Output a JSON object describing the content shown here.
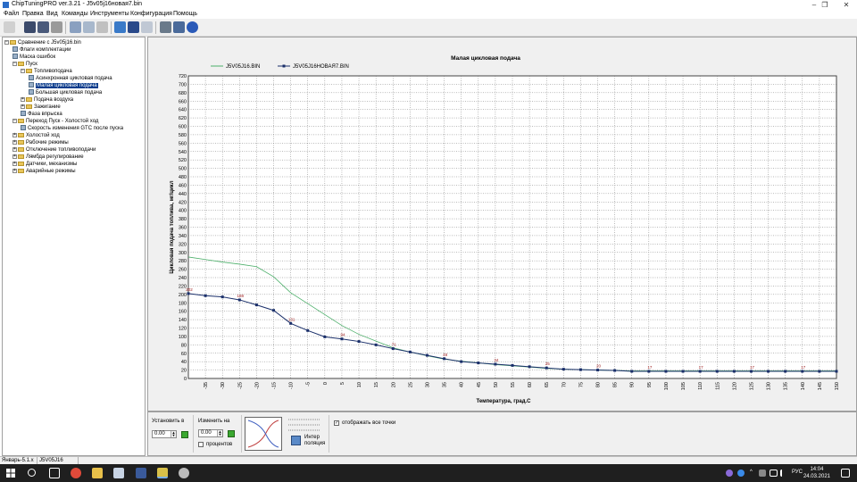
{
  "window": {
    "title": "ChipTuningPRO ver.3.21 - J5v05j16новая7.bin",
    "minimize": "–",
    "maximize": "❐",
    "close": "✕"
  },
  "menu": [
    "Файл",
    "Правка",
    "Вид",
    "Команды",
    "Инструменты",
    "Конфигурация",
    "Помощь"
  ],
  "tree": [
    {
      "label": "Сравнение с J5v05j16.bin",
      "level": 0,
      "exp": "−",
      "kind": "folder"
    },
    {
      "label": "Флаги комплектации",
      "level": 1,
      "exp": "",
      "kind": "leaf"
    },
    {
      "label": "Маска ошибок",
      "level": 1,
      "exp": "",
      "kind": "leaf"
    },
    {
      "label": "Пуск",
      "level": 1,
      "exp": "−",
      "kind": "folder"
    },
    {
      "label": "Топливоподача",
      "level": 2,
      "exp": "−",
      "kind": "folder"
    },
    {
      "label": "Асинхронная цикловая подача",
      "level": 3,
      "exp": "",
      "kind": "leaf"
    },
    {
      "label": "Малая цикловая подача",
      "level": 3,
      "exp": "",
      "kind": "leaf",
      "selected": true
    },
    {
      "label": "Большая цикловая подача",
      "level": 3,
      "exp": "",
      "kind": "leaf"
    },
    {
      "label": "Подача воздуха",
      "level": 2,
      "exp": "+",
      "kind": "folder"
    },
    {
      "label": "Зажигание",
      "level": 2,
      "exp": "+",
      "kind": "folder"
    },
    {
      "label": "Фаза впрыска",
      "level": 2,
      "exp": "",
      "kind": "leaf"
    },
    {
      "label": "Переход Пуск - Холостой ход",
      "level": 1,
      "exp": "−",
      "kind": "folder"
    },
    {
      "label": "Скорость изменения GTC после пуска",
      "level": 2,
      "exp": "",
      "kind": "leaf"
    },
    {
      "label": "Холостой ход",
      "level": 1,
      "exp": "+",
      "kind": "folder"
    },
    {
      "label": "Рабочие режимы",
      "level": 1,
      "exp": "+",
      "kind": "folder"
    },
    {
      "label": "Отключение топливоподачи",
      "level": 1,
      "exp": "+",
      "kind": "folder"
    },
    {
      "label": "Лямбда регулирование",
      "level": 1,
      "exp": "+",
      "kind": "folder"
    },
    {
      "label": "Датчики, механизмы",
      "level": 1,
      "exp": "+",
      "kind": "folder"
    },
    {
      "label": "Аварийные режимы",
      "level": 1,
      "exp": "+",
      "kind": "folder"
    }
  ],
  "bottom": {
    "set_label": "Установить в",
    "set_value": "0.00",
    "change_label": "Изменить на",
    "change_value": "0.00",
    "percent_label": "процентов",
    "interp_label_1": "Интер",
    "interp_label_2": "поляция",
    "show_all_label": "отображать все точки",
    "show_all_checked": "✓"
  },
  "status": [
    "Январь-5.1.x",
    "J5V05J16"
  ],
  "taskbar": {
    "lang": "РУС",
    "time": "14:04",
    "date": "24.03.2021"
  },
  "chart_data": {
    "type": "line",
    "title": "Малая цикловая подача",
    "xlabel": "Температура, град.С",
    "ylabel": "Цикловая подача топлива, мг/цикл",
    "x": [
      -40,
      -35,
      -30,
      -25,
      -20,
      -15,
      -10,
      -5,
      0,
      5,
      10,
      15,
      20,
      25,
      30,
      35,
      40,
      45,
      50,
      55,
      60,
      65,
      70,
      75,
      80,
      85,
      90,
      95,
      100,
      105,
      110,
      115,
      120,
      125,
      130,
      135,
      140,
      145,
      150
    ],
    "xlim": [
      -40,
      150
    ],
    "ylim": [
      0,
      720
    ],
    "ytick_step": 20,
    "xticks": [
      -35,
      -30,
      -25,
      -20,
      -15,
      -10,
      -5,
      0,
      5,
      10,
      15,
      20,
      25,
      30,
      35,
      40,
      45,
      50,
      55,
      60,
      65,
      70,
      75,
      80,
      85,
      90,
      95,
      100,
      105,
      110,
      115,
      120,
      125,
      130,
      135,
      140,
      145,
      150
    ],
    "series": [
      {
        "name": "J5V05J16.BIN",
        "color": "#4caf6a",
        "marker": false,
        "values": [
          289,
          283,
          277,
          272,
          266,
          242,
          204,
          178,
          152,
          126,
          105,
          89,
          73,
          63,
          54,
          46,
          41,
          37,
          33,
          30,
          27,
          24,
          22,
          21,
          20,
          19,
          18,
          18,
          18,
          18,
          18,
          18,
          18,
          18,
          18,
          18,
          18,
          18,
          18
        ]
      },
      {
        "name": "J5V05J16НОВАЯ7.BIN",
        "color": "#1a2f6a",
        "marker": true,
        "values": [
          202,
          197,
          194,
          187,
          175,
          162,
          131,
          114,
          99,
          94,
          88,
          80,
          71,
          63,
          55,
          47,
          40,
          37,
          34,
          31,
          28,
          25,
          22,
          21,
          20,
          19,
          17,
          17,
          17,
          17,
          17,
          17,
          17,
          17,
          17,
          17,
          17,
          17,
          17
        ]
      }
    ],
    "point_labels": [
      {
        "x": -40,
        "y": 202,
        "text": "202"
      },
      {
        "x": -25,
        "y": 187,
        "text": "188"
      },
      {
        "x": -10,
        "y": 131,
        "text": "131"
      },
      {
        "x": 5,
        "y": 94,
        "text": "94"
      },
      {
        "x": 20,
        "y": 71,
        "text": "71"
      },
      {
        "x": 35,
        "y": 47,
        "text": "48"
      },
      {
        "x": 50,
        "y": 34,
        "text": "34"
      },
      {
        "x": 65,
        "y": 25,
        "text": "25"
      },
      {
        "x": 80,
        "y": 20,
        "text": "20"
      },
      {
        "x": 95,
        "y": 17,
        "text": "17"
      },
      {
        "x": 110,
        "y": 17,
        "text": "17"
      },
      {
        "x": 125,
        "y": 17,
        "text": "17"
      },
      {
        "x": 140,
        "y": 17,
        "text": "17"
      }
    ],
    "grid": true,
    "legend": "top-left"
  }
}
